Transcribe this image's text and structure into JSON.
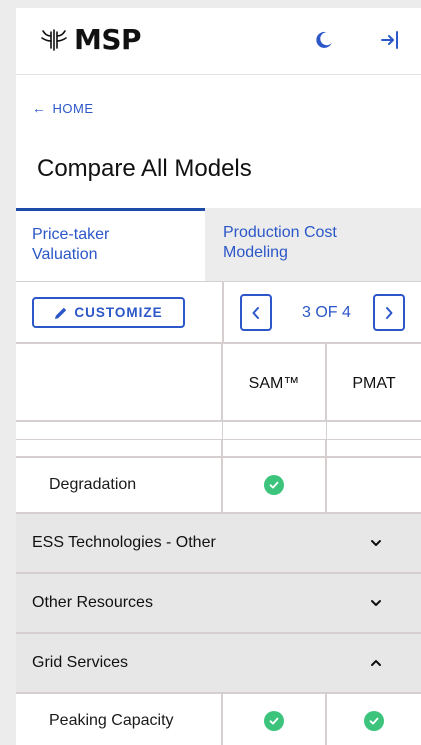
{
  "header": {
    "logo_text": "MSP",
    "icons": [
      "logo-mark-icon",
      "moon-icon",
      "sign-in-icon"
    ]
  },
  "nav": {
    "back_label": "HOME",
    "page_title": "Compare All Models"
  },
  "tabs": [
    {
      "label_line1": "Price-taker",
      "label_line2": "Valuation",
      "active": true
    },
    {
      "label_line1": "Production Cost",
      "label_line2": "Modeling",
      "active": false
    }
  ],
  "controls": {
    "customize_label": "CUSTOMIZE",
    "pager_text": "3 OF 4"
  },
  "table": {
    "columns": [
      "",
      "SAM™",
      "PMAT"
    ],
    "rows": [
      {
        "type": "feature",
        "label": "Degradation",
        "values": [
          true,
          false
        ]
      },
      {
        "type": "section",
        "label": "ESS Technologies - Other",
        "expanded": false
      },
      {
        "type": "section",
        "label": "Other Resources",
        "expanded": false
      },
      {
        "type": "section",
        "label": "Grid Services",
        "expanded": true
      },
      {
        "type": "feature",
        "label": "Peaking Capacity",
        "values": [
          true,
          true
        ]
      }
    ]
  },
  "colors": {
    "accent": "#2b57c8",
    "check": "#3cc47c",
    "section_bg": "#e7e7e7",
    "grid_line": "#d6cfcf"
  }
}
